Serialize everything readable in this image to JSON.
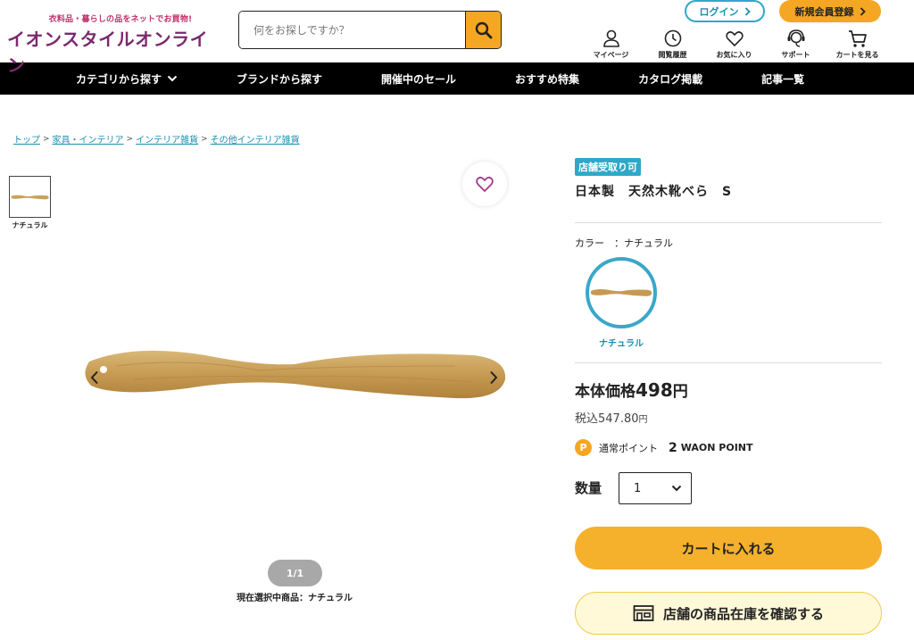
{
  "header": {
    "logo_tagline": "衣料品・暮らしの品をネットでお買物!",
    "logo_text": "イオンスタイルオンライン",
    "search_placeholder": "何をお探しですか？",
    "login_label": "ログイン",
    "register_label": "新規会員登録",
    "util_nav": [
      {
        "label": "マイページ",
        "icon": "user-icon"
      },
      {
        "label": "閲覧履歴",
        "icon": "clock-icon"
      },
      {
        "label": "お気に入り",
        "icon": "heart-icon"
      },
      {
        "label": "サポート",
        "icon": "headset-icon"
      },
      {
        "label": "カートを見る",
        "icon": "cart-icon"
      }
    ]
  },
  "global_nav": [
    {
      "label": "カテゴリから探す",
      "icon": "chevron-down-icon"
    },
    {
      "label": "ブランドから探す"
    },
    {
      "label": "開催中のセール"
    },
    {
      "label": "おすすめ特集"
    },
    {
      "label": "カタログ掲載"
    },
    {
      "label": "記事一覧"
    }
  ],
  "breadcrumb": [
    {
      "label": "トップ"
    },
    {
      "label": "家具・インテリア"
    },
    {
      "label": "インテリア雑貨"
    },
    {
      "label": "その他インテリア雑貨"
    }
  ],
  "gallery": {
    "thumb_label": "ナチュラル",
    "pager": "1/1",
    "selected_note": "現在選択中商品：ナチュラル"
  },
  "product": {
    "badge": "店舗受取り可",
    "title": "日本製　天然木靴べら　S",
    "color_label": "カラー　：ナチュラル",
    "swatch_label": "ナチュラル",
    "price_prefix": "本体価格",
    "price_value": "498",
    "price_unit": "円",
    "tax_prefix": "税込",
    "tax_value": "547.80",
    "tax_unit": "円",
    "points_icon": "P",
    "points_label": "通常ポイント",
    "points_value": "2",
    "points_unit": "WAON POINT",
    "qty_label": "数量",
    "qty_value": "1",
    "cart_button": "カートに入れる",
    "store_button": "店舗の商品在庫を確認する"
  },
  "colors": {
    "accent_orange": "#f5a623",
    "accent_blue": "#2fa8c8",
    "logo_purple": "#7a2a6e",
    "nav_bg": "#000000"
  }
}
